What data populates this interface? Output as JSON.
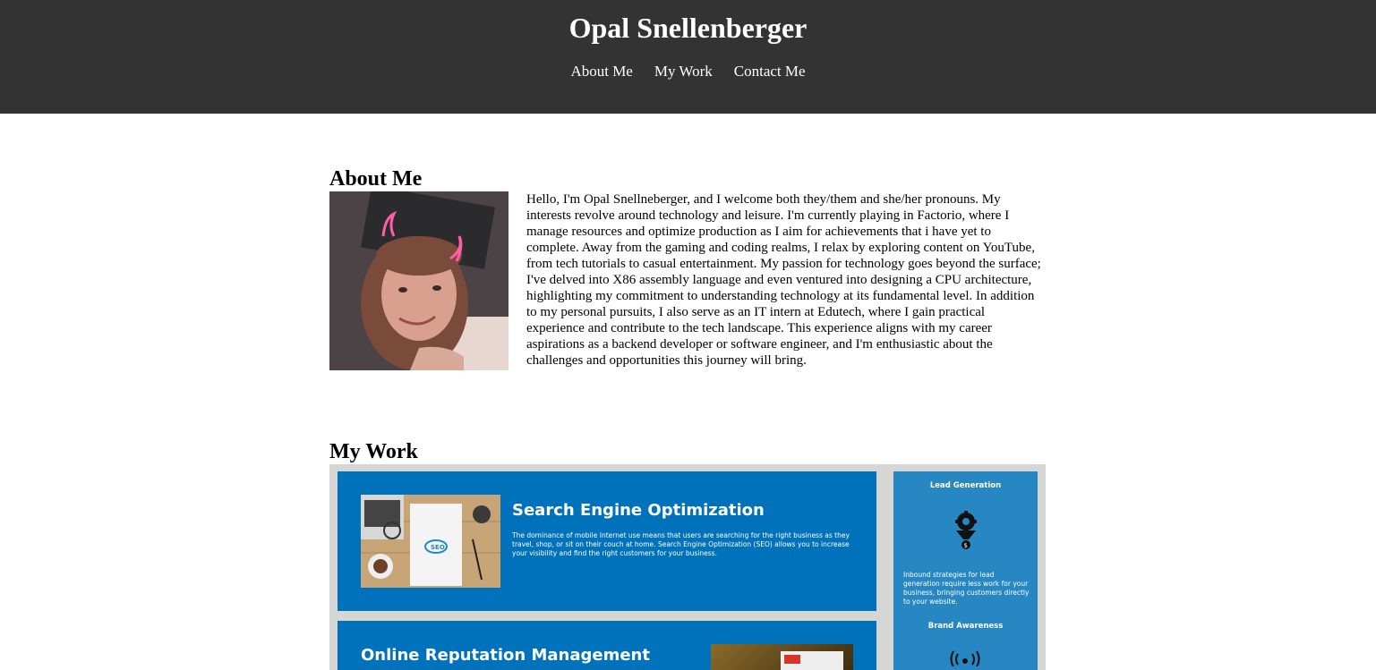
{
  "header": {
    "title": "Opal Snellenberger",
    "nav": [
      "About Me",
      "My Work",
      "Contact Me"
    ]
  },
  "about": {
    "heading": "About Me",
    "portrait_icon": "profile-photo",
    "text": "Hello, I'm Opal Snellneberger, and I welcome both they/them and she/her pronouns. My interests revolve around technology and leisure. I'm currently playing in Factorio, where I manage resources and optimize production as I aim for achievements that i have yet to complete. Away from the gaming and coding realms, I relax by exploring content on YouTube, from tech tutorials to casual entertainment. My passion for technology goes beyond the surface; I've delved into X86 assembly language and even ventured into designing a CPU architecture, highlighting my commitment to understanding technology at its fundamental level. In addition to my personal pursuits, I also serve as an IT intern at Edutech, where I gain practical experience and contribute to the tech landscape. This experience aligns with my career aspirations as a backend developer or software engineer, and I'm enthusiastic about the challenges and opportunities this journey will bring."
  },
  "work": {
    "heading": "My Work",
    "screenshot": {
      "main_card": {
        "title": "Search Engine Optimization",
        "description": "The dominance of mobile Internet use means that users are searching for the right business as they travel, shop, or sit on their couch at home. Search Engine Optimization (SEO) allows you to increase your visibility and find the right customers for your business.",
        "thumb_icon": "seo-desk-image"
      },
      "second_card": {
        "title": "Online Reputation Management"
      },
      "side_card": {
        "title": "Lead Generation",
        "icon": "gear-funnel-icon",
        "description": "Inbound strategies for lead generation require less work for your business, bringing customers directly to your website.",
        "title_2": "Brand Awareness",
        "icon_2": "broadcast-icon"
      }
    }
  },
  "colors": {
    "header_bg": "#333333",
    "card_blue": "#0072bc",
    "side_blue": "#2687c2",
    "panel_bg": "#d6d7d5"
  }
}
